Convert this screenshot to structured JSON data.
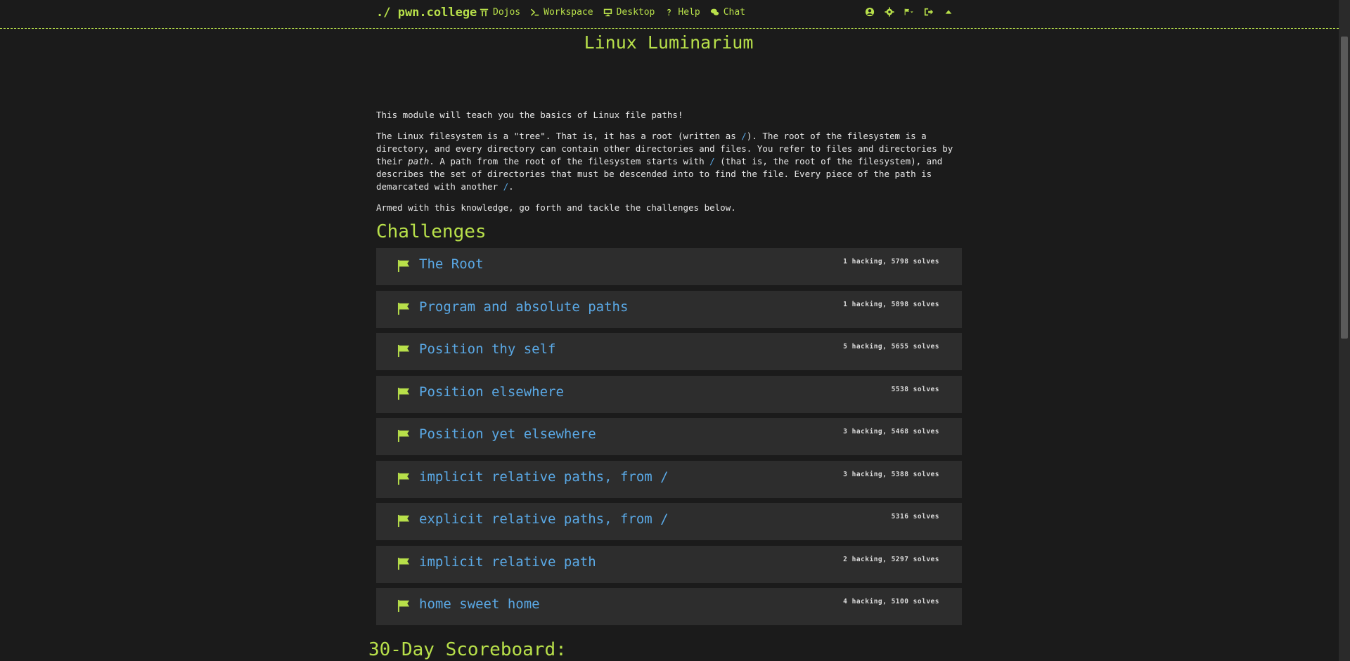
{
  "navbar": {
    "brand": "./ pwn.college",
    "links": [
      {
        "label": "Dojos",
        "icon": "dojo-icon"
      },
      {
        "label": "Workspace",
        "icon": "terminal-icon"
      },
      {
        "label": "Desktop",
        "icon": "desktop-icon"
      },
      {
        "label": "Help",
        "icon": "question-icon"
      },
      {
        "label": "Chat",
        "icon": "chat-icon"
      }
    ],
    "right_icons": [
      "user-icon",
      "settings-icon",
      "flag-dropdown-icon",
      "logout-icon",
      "chevron-up-icon"
    ]
  },
  "module": {
    "title": "Linux Luminarium",
    "intro": "This module will teach you the basics of Linux file paths!",
    "p2_a": "The Linux filesystem is a \"tree\". That is, it has a root (written as ",
    "p2_root": "/",
    "p2_b": "). The root of the filesystem is a directory, and every directory can contain other directories and files. You refer to files and directories by their ",
    "p2_path": "path",
    "p2_c": ". A path from the root of the filesystem starts with ",
    "p2_slash1": "/",
    "p2_d": " (that is, the root of the filesystem), and describes the set of directories that must be descended into to find the file. Every piece of the path is demarcated with another ",
    "p2_slash2": "/",
    "p2_e": ".",
    "p3": "Armed with this knowledge, go forth and tackle the challenges below."
  },
  "challenges_heading": "Challenges",
  "challenges": [
    {
      "name": "The Root",
      "stats": "1 hacking, 5798 solves"
    },
    {
      "name": "Program and absolute paths",
      "stats": "1 hacking, 5898 solves"
    },
    {
      "name": "Position thy self",
      "stats": "5 hacking, 5655 solves"
    },
    {
      "name": "Position elsewhere",
      "stats": "5538 solves"
    },
    {
      "name": "Position yet elsewhere",
      "stats": "3 hacking, 5468 solves"
    },
    {
      "name": "implicit relative paths, from /",
      "stats": "3 hacking, 5388 solves"
    },
    {
      "name": "explicit relative paths, from /",
      "stats": "5316 solves"
    },
    {
      "name": "implicit relative path",
      "stats": "2 hacking, 5297 solves"
    },
    {
      "name": "home sweet home",
      "stats": "4 hacking, 5100 solves"
    }
  ],
  "scoreboard_heading": "30-Day Scoreboard:",
  "colors": {
    "accent": "#b8e04a",
    "link": "#5aa9e6",
    "background": "#1b1b1b",
    "card": "#2d2d2d"
  }
}
